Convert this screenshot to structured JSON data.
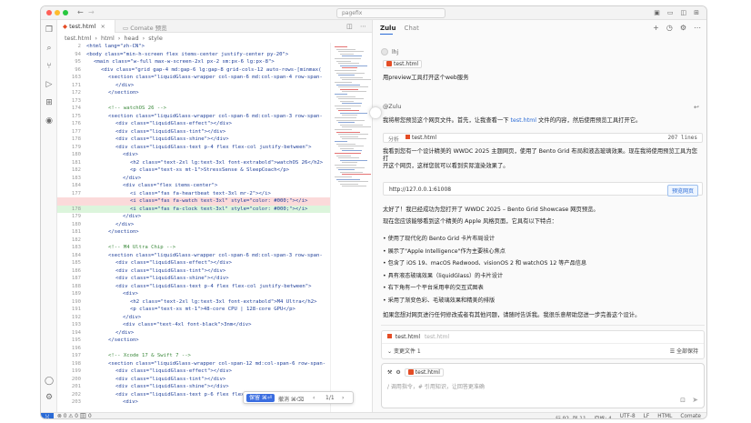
{
  "window": {
    "title": "pagefix"
  },
  "editor": {
    "tabs": [
      {
        "label": "test.html",
        "active": true
      },
      {
        "label": "Comate 预览",
        "active": false
      }
    ],
    "breadcrumb": [
      "test.html",
      "html",
      "head",
      "style"
    ],
    "lines": [
      {
        "n": "2",
        "code": "<html lang=\"zh-CN\">",
        "indent": 0,
        "kind": ""
      },
      {
        "n": "94",
        "code": "<body class=\"min-h-screen flex items-center justify-center py-20\">",
        "indent": 0,
        "kind": ""
      },
      {
        "n": "95",
        "code": "<main class=\"w-full max-w-screen-2xl px-2 sm:px-6 lg:px-8\">",
        "indent": 1,
        "kind": ""
      },
      {
        "n": "96",
        "code": "<div class=\"grid gap-4 md:gap-6 lg:gap-8 grid-cols-12 auto-rows-[minmax(",
        "indent": 2,
        "kind": ""
      },
      {
        "n": "163",
        "code": "<section class=\"liquidGlass-wrapper col-span-6 md:col-span-4 row-span-",
        "indent": 3,
        "kind": ""
      },
      {
        "n": "171",
        "code": "</div>",
        "indent": 4,
        "kind": ""
      },
      {
        "n": "172",
        "code": "</section>",
        "indent": 3,
        "kind": ""
      },
      {
        "n": "173",
        "code": "",
        "indent": 0,
        "kind": ""
      },
      {
        "n": "174",
        "code": "<!-- watchOS 26 -->",
        "indent": 3,
        "kind": ""
      },
      {
        "n": "175",
        "code": "<section class=\"liquidGlass-wrapper col-span-6 md:col-span-3 row-span-",
        "indent": 3,
        "kind": ""
      },
      {
        "n": "176",
        "code": "<div class=\"liquidGlass-effect\"></div>",
        "indent": 4,
        "kind": ""
      },
      {
        "n": "177",
        "code": "<div class=\"liquidGlass-tint\"></div>",
        "indent": 4,
        "kind": ""
      },
      {
        "n": "178",
        "code": "<div class=\"liquidGlass-shine\"></div>",
        "indent": 4,
        "kind": ""
      },
      {
        "n": "179",
        "code": "<div class=\"liquidGlass-text p-4 flex flex-col justify-between\">",
        "indent": 4,
        "kind": ""
      },
      {
        "n": "180",
        "code": "<div>",
        "indent": 5,
        "kind": ""
      },
      {
        "n": "181",
        "code": "<h2 class=\"text-2xl lg:text-3xl font-extrabold\">watchOS 26</h2>",
        "indent": 6,
        "kind": ""
      },
      {
        "n": "182",
        "code": "<p class=\"text-xs mt-1\">StressSense & SleepCoach</p>",
        "indent": 6,
        "kind": ""
      },
      {
        "n": "183",
        "code": "</div>",
        "indent": 5,
        "kind": ""
      },
      {
        "n": "184",
        "code": "<div class=\"flex items-center\">",
        "indent": 5,
        "kind": ""
      },
      {
        "n": "177",
        "code": "<i class=\"fas fa-heartbeat text-3xl mr-2\"></i>",
        "indent": 6,
        "kind": ""
      },
      {
        "n": "",
        "code": "<i class=\"fas fa-watch text-3xl\" style=\"color: #000;\"></i>",
        "indent": 6,
        "kind": "del"
      },
      {
        "n": "178",
        "code": "<i class=\"fas fa-clock text-3xl\" style=\"color: #000;\"></i>",
        "indent": 6,
        "kind": "add"
      },
      {
        "n": "179",
        "code": "</div>",
        "indent": 5,
        "kind": ""
      },
      {
        "n": "180",
        "code": "</div>",
        "indent": 4,
        "kind": ""
      },
      {
        "n": "181",
        "code": "</section>",
        "indent": 3,
        "kind": ""
      },
      {
        "n": "182",
        "code": "",
        "indent": 0,
        "kind": ""
      },
      {
        "n": "183",
        "code": "<!-- M4 Ultra Chip -->",
        "indent": 3,
        "kind": ""
      },
      {
        "n": "184",
        "code": "<section class=\"liquidGlass-wrapper col-span-6 md:col-span-3 row-span-",
        "indent": 3,
        "kind": ""
      },
      {
        "n": "185",
        "code": "<div class=\"liquidGlass-effect\"></div>",
        "indent": 4,
        "kind": ""
      },
      {
        "n": "186",
        "code": "<div class=\"liquidGlass-tint\"></div>",
        "indent": 4,
        "kind": ""
      },
      {
        "n": "187",
        "code": "<div class=\"liquidGlass-shine\"></div>",
        "indent": 4,
        "kind": ""
      },
      {
        "n": "188",
        "code": "<div class=\"liquidGlass-text p-4 flex flex-col justify-between\">",
        "indent": 4,
        "kind": ""
      },
      {
        "n": "189",
        "code": "<div>",
        "indent": 5,
        "kind": ""
      },
      {
        "n": "190",
        "code": "<h2 class=\"text-2xl lg:text-3xl font-extrabold\">M4 Ultra</h2>",
        "indent": 6,
        "kind": ""
      },
      {
        "n": "191",
        "code": "<p class=\"text-xs mt-1\">48-core CPU | 128-core GPU</p>",
        "indent": 6,
        "kind": ""
      },
      {
        "n": "192",
        "code": "</div>",
        "indent": 5,
        "kind": ""
      },
      {
        "n": "193",
        "code": "<div class=\"text-4xl font-black\">3nm</div>",
        "indent": 5,
        "kind": ""
      },
      {
        "n": "194",
        "code": "</div>",
        "indent": 4,
        "kind": ""
      },
      {
        "n": "195",
        "code": "</section>",
        "indent": 3,
        "kind": ""
      },
      {
        "n": "196",
        "code": "",
        "indent": 0,
        "kind": ""
      },
      {
        "n": "197",
        "code": "<!-- Xcode 17 & Swift 7 -->",
        "indent": 3,
        "kind": ""
      },
      {
        "n": "198",
        "code": "<section class=\"liquidGlass-wrapper col-span-12 md:col-span-6 row-span-",
        "indent": 3,
        "kind": ""
      },
      {
        "n": "199",
        "code": "<div class=\"liquidGlass-effect\"></div>",
        "indent": 4,
        "kind": ""
      },
      {
        "n": "200",
        "code": "<div class=\"liquidGlass-tint\"></div>",
        "indent": 4,
        "kind": ""
      },
      {
        "n": "201",
        "code": "<div class=\"liquidGlass-shine\"></div>",
        "indent": 4,
        "kind": ""
      },
      {
        "n": "202",
        "code": "<div class=\"liquidGlass-text p-6 flex flex-col md:flex-row items-sta",
        "indent": 4,
        "kind": ""
      },
      {
        "n": "203",
        "code": "<div>",
        "indent": 5,
        "kind": ""
      }
    ],
    "find": {
      "keep": "保留 ⌘⏎",
      "undo": "撤消 ⌘⌫",
      "count": "1/1"
    }
  },
  "status": {
    "left": "⊗ 0 ⚠ 0 🗄 0",
    "items": [
      "行 92, 列 11",
      "空格: 4",
      "UTF-8",
      "LF",
      "HTML",
      "Comate"
    ]
  },
  "chat": {
    "tabs": [
      "Zulu",
      "Chat"
    ],
    "user_name": "lhj",
    "attached_file": "test.html",
    "user_message": "用preview工具打开这个web服务",
    "bot_name": "@Zulu",
    "bot_intro_prefix": "我将帮您预览这个网页文件。首先，让我查看一下 ",
    "bot_intro_link": "test.html",
    "bot_intro_suffix": " 文件的内容，然后使用预览工具打开它。",
    "analyze_label": "分析",
    "analyze_file": "test.html",
    "analyze_lines": "207 lines",
    "para2_a": "我看到您有一个设计精美的 WWDC 2025 主题网页，使用了 Bento Grid 布局和液态玻璃效果。现在我将使用预览工具为您打",
    "para2_b": "开这个网页，这样您就可以看到实际渲染效果了。",
    "url": "http://127.0.0.1:61008",
    "preview_button": "预览网页",
    "para3": "太好了！我已经成功为您打开了 WWDC 2025 – Bento Grid Showcase 网页预览。",
    "para4": "现在您应该能够看到这个精美的 Apple 风格页面，它具有以下特点：",
    "bullets": [
      "使用了现代化的 Bento Grid 卡片布局设计",
      "展示了\"Apple Intelligence\"作为主要核心焦点",
      "包含了 iOS 19、macOS Redwood、visionOS 2 和 watchOS 12 等产品信息",
      "具有液态玻璃效果（liquidGlass）的卡片设计",
      "右下角有一个平台采用率的交互式图表",
      "采用了渐变色彩、毛玻璃效果和精美的排版"
    ],
    "closing": "如果您想对网页进行任何修改或者有其他问题，请随时告诉我。我很乐意帮助您进一步完善这个设计。",
    "changes_file": "test.html",
    "changes_file_sub": "test.html",
    "changes_label": "变更文件 1",
    "accept_all": "全部保持",
    "input_chip": "test.html",
    "input_placeholder": "/ 调用指令，# 引用知识，让回答更准确"
  }
}
